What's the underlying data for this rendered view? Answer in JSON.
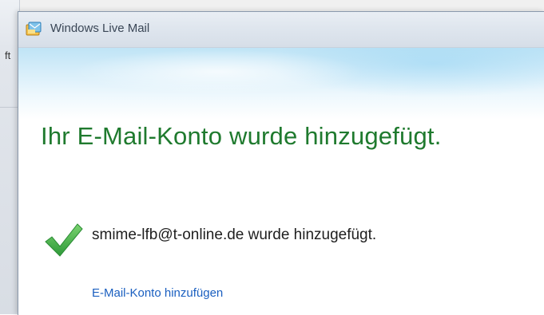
{
  "background": {
    "partial_text": "ft"
  },
  "window": {
    "title": "Windows Live Mail",
    "app_icon": "windows-live-mail-icon"
  },
  "content": {
    "heading": "Ihr E-Mail-Konto wurde hinzugefügt.",
    "status_icon": "checkmark-icon",
    "status_message": "smime-lfb@t-online.de wurde hinzugefügt.",
    "add_account_link": "E-Mail-Konto hinzufügen"
  },
  "colors": {
    "heading": "#1f7a2e",
    "link": "#1a5fc0",
    "checkmark": "#3fb54a"
  }
}
